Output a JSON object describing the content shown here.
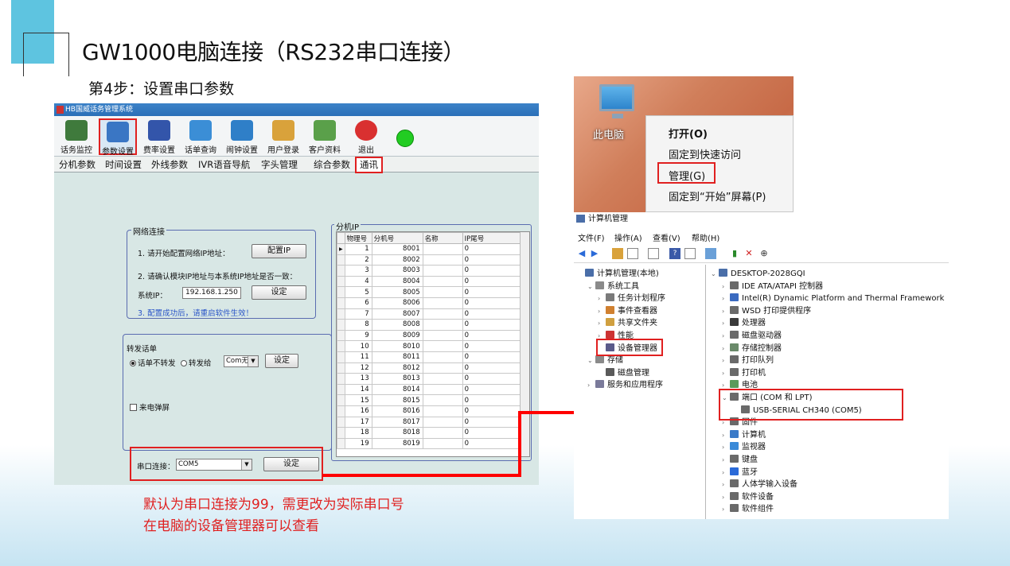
{
  "slide": {
    "title": "GW1000电脑连接（RS232串口连接）",
    "step": "第4步：设置串口参数",
    "caption_lines": [
      "默认为串口连接为99，需更改为实际串口号",
      "在电脑的设备管理器可以查看"
    ]
  },
  "app": {
    "window_title": "HB国威话务管理系统",
    "toolbar": [
      {
        "label": "话务监控",
        "icon": "monitor-icon",
        "color": "#3f7a3c"
      },
      {
        "label": "参数设置",
        "icon": "settings-icon",
        "color": "#3a76c4"
      },
      {
        "label": "费率设置",
        "icon": "rate-icon",
        "color": "#3355aa"
      },
      {
        "label": "话单查询",
        "icon": "query-icon",
        "color": "#3b8ed6"
      },
      {
        "label": "闹钟设置",
        "icon": "alarm-icon",
        "color": "#2f7fc8"
      },
      {
        "label": "用户登录",
        "icon": "user-login-icon",
        "color": "#d9a23b"
      },
      {
        "label": "客户资料",
        "icon": "customer-icon",
        "color": "#5aa04a"
      },
      {
        "label": "退出",
        "icon": "exit-icon",
        "color": "#d93030"
      }
    ],
    "tabs": [
      "分机参数",
      "时间设置",
      "外线参数",
      "IVR语音导航",
      "字头管理",
      "综合参数",
      "通讯"
    ],
    "network": {
      "title": "网络连接",
      "step1": "1. 请开始配置网络IP地址：",
      "config_ip_btn": "配置IP",
      "step2": "2. 请确认模块IP地址与本系统IP地址是否一致：",
      "system_ip_label": "系统IP：",
      "system_ip_value": "192.168.1.250",
      "set_btn": "设定",
      "step3": "3. 配置成功后，请重启软件生效！"
    },
    "forward": {
      "title": "转发话单",
      "no_forward": "话单不转发",
      "forward_to": "转发给",
      "com_value": "Com无",
      "set_btn": "设定",
      "popup_label": "来电弹屏"
    },
    "serial": {
      "label": "串口连接：",
      "value": "COM5",
      "set_btn": "设定"
    },
    "ext_ip": {
      "title": "分机IP",
      "columns": [
        "物理号",
        "分机号",
        "名称",
        "IP尾号"
      ],
      "rows": [
        [
          "1",
          "8001",
          "",
          "0"
        ],
        [
          "2",
          "8002",
          "",
          "0"
        ],
        [
          "3",
          "8003",
          "",
          "0"
        ],
        [
          "4",
          "8004",
          "",
          "0"
        ],
        [
          "5",
          "8005",
          "",
          "0"
        ],
        [
          "6",
          "8006",
          "",
          "0"
        ],
        [
          "7",
          "8007",
          "",
          "0"
        ],
        [
          "8",
          "8008",
          "",
          "0"
        ],
        [
          "9",
          "8009",
          "",
          "0"
        ],
        [
          "10",
          "8010",
          "",
          "0"
        ],
        [
          "11",
          "8011",
          "",
          "0"
        ],
        [
          "12",
          "8012",
          "",
          "0"
        ],
        [
          "13",
          "8013",
          "",
          "0"
        ],
        [
          "14",
          "8014",
          "",
          "0"
        ],
        [
          "15",
          "8015",
          "",
          "0"
        ],
        [
          "16",
          "8016",
          "",
          "0"
        ],
        [
          "17",
          "8017",
          "",
          "0"
        ],
        [
          "18",
          "8018",
          "",
          "0"
        ],
        [
          "19",
          "8019",
          "",
          "0"
        ]
      ]
    }
  },
  "context_menu": {
    "desktop_label": "此电脑",
    "items": [
      "打开(O)",
      "固定到快速访问",
      "管理(G)",
      "固定到“开始”屏幕(P)"
    ]
  },
  "computer_management": {
    "window_title": "计算机管理",
    "menus": [
      "文件(F)",
      "操作(A)",
      "查看(V)",
      "帮助(H)"
    ],
    "left_tree": [
      {
        "label": "计算机管理(本地)",
        "level": 0,
        "expander": "",
        "color": "#4a6ea8"
      },
      {
        "label": "系统工具",
        "level": 1,
        "expander": "⌄",
        "color": "#8a8a8a"
      },
      {
        "label": "任务计划程序",
        "level": 2,
        "expander": "›",
        "color": "#7a7a7a"
      },
      {
        "label": "事件查看器",
        "level": 2,
        "expander": "›",
        "color": "#d08030"
      },
      {
        "label": "共享文件夹",
        "level": 2,
        "expander": "›",
        "color": "#d0a040"
      },
      {
        "label": "性能",
        "level": 2,
        "expander": "›",
        "color": "#cc3333"
      },
      {
        "label": "设备管理器",
        "level": 2,
        "expander": "",
        "color": "#5a5a8a"
      },
      {
        "label": "存储",
        "level": 1,
        "expander": "⌄",
        "color": "#8a8a8a"
      },
      {
        "label": "磁盘管理",
        "level": 2,
        "expander": "",
        "color": "#5a5a5a"
      },
      {
        "label": "服务和应用程序",
        "level": 1,
        "expander": "›",
        "color": "#7a7a9a"
      }
    ],
    "device_tree": [
      {
        "label": "DESKTOP-2028GQI",
        "level": 0,
        "expander": "⌄",
        "color": "#4a6ea8"
      },
      {
        "label": "IDE ATA/ATAPI 控制器",
        "level": 1,
        "expander": "›",
        "color": "#6a6a6a"
      },
      {
        "label": "Intel(R) Dynamic Platform and Thermal Framework",
        "level": 1,
        "expander": "›",
        "color": "#3a6ac0"
      },
      {
        "label": "WSD 打印提供程序",
        "level": 1,
        "expander": "›",
        "color": "#6a6a6a"
      },
      {
        "label": "处理器",
        "level": 1,
        "expander": "›",
        "color": "#3a3a3a"
      },
      {
        "label": "磁盘驱动器",
        "level": 1,
        "expander": "›",
        "color": "#6a6a6a"
      },
      {
        "label": "存储控制器",
        "level": 1,
        "expander": "›",
        "color": "#6a8a6a"
      },
      {
        "label": "打印队列",
        "level": 1,
        "expander": "›",
        "color": "#6a6a6a"
      },
      {
        "label": "打印机",
        "level": 1,
        "expander": "›",
        "color": "#6a6a6a"
      },
      {
        "label": "电池",
        "level": 1,
        "expander": "›",
        "color": "#5a9a5a"
      },
      {
        "label": "端口 (COM 和 LPT)",
        "level": 1,
        "expander": "⌄",
        "color": "#6a6a6a"
      },
      {
        "label": "USB-SERIAL CH340 (COM5)",
        "level": 2,
        "expander": "",
        "color": "#6a6a6a"
      },
      {
        "label": "固件",
        "level": 1,
        "expander": "›",
        "color": "#6a6a6a"
      },
      {
        "label": "计算机",
        "level": 1,
        "expander": "›",
        "color": "#3a7ac8"
      },
      {
        "label": "监视器",
        "level": 1,
        "expander": "›",
        "color": "#3a8ad8"
      },
      {
        "label": "键盘",
        "level": 1,
        "expander": "›",
        "color": "#6a6a6a"
      },
      {
        "label": "蓝牙",
        "level": 1,
        "expander": "›",
        "color": "#2a6ad8"
      },
      {
        "label": "人体学输入设备",
        "level": 1,
        "expander": "›",
        "color": "#6a6a6a"
      },
      {
        "label": "软件设备",
        "level": 1,
        "expander": "›",
        "color": "#6a6a6a"
      },
      {
        "label": "软件组件",
        "level": 1,
        "expander": "›",
        "color": "#6a6a6a"
      }
    ]
  }
}
